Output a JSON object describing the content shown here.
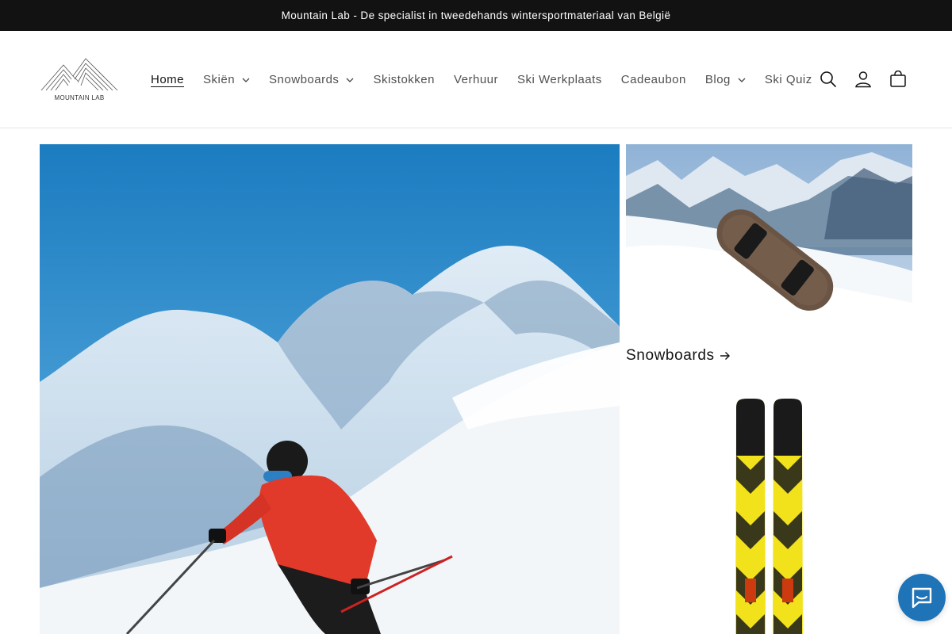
{
  "announcement": {
    "text": "Mountain Lab - De specialist in tweedehands wintersportmateriaal van België"
  },
  "logo": {
    "text": "MOUNTAIN LAB"
  },
  "nav": {
    "items": [
      {
        "label": "Home",
        "active": true,
        "dropdown": false
      },
      {
        "label": "Skiën",
        "active": false,
        "dropdown": true
      },
      {
        "label": "Snowboards",
        "active": false,
        "dropdown": true
      },
      {
        "label": "Skistokken",
        "active": false,
        "dropdown": false
      },
      {
        "label": "Verhuur",
        "active": false,
        "dropdown": false
      },
      {
        "label": "Ski Werkplaats",
        "active": false,
        "dropdown": false
      },
      {
        "label": "Cadeaubon",
        "active": false,
        "dropdown": false
      },
      {
        "label": "Blog",
        "active": false,
        "dropdown": true
      },
      {
        "label": "Ski Quiz",
        "active": false,
        "dropdown": false
      }
    ]
  },
  "header_icons": [
    "search-icon",
    "account-icon",
    "cart-icon"
  ],
  "collections": [
    {
      "title": "Snowboards"
    }
  ],
  "colors": {
    "announcement_bg": "#121212",
    "chat_button": "#1f73b7",
    "ski_yellow": "#f2e21b"
  }
}
